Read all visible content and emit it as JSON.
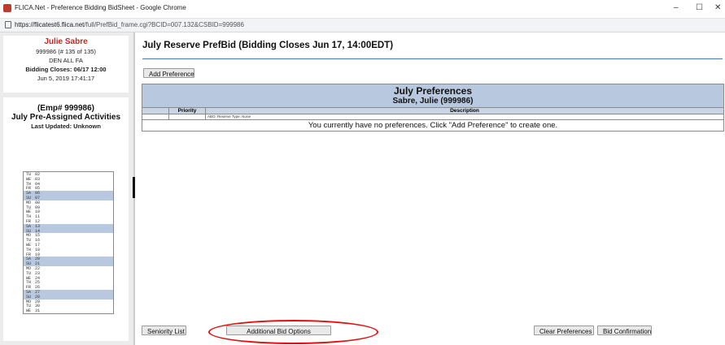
{
  "browser": {
    "window_title": "FLICA.Net - Preference Bidding BidSheet - Google Chrome",
    "url_host": "https://flicatest6.flica.net",
    "url_path": "/full/PrefBid_frame.cgi?BCID=007.132&CSBID=999986",
    "minimize": "–",
    "maximize": "☐",
    "close": "✕"
  },
  "user": {
    "name": "Julie Sabre",
    "id_line": "999986 (# 135 of 135)",
    "base_line": "DEN ALL FA",
    "bidding_closes": "Bidding Closes: 06/17 12:00",
    "timestamp": "Jun 5, 2019 17:41:17"
  },
  "activities": {
    "emp": "(Emp# 999986)",
    "title": "July Pre-Assigned Activities",
    "updated": "Last Updated: Unknown",
    "days": [
      {
        "dow": "TU",
        "d": "02"
      },
      {
        "dow": "WE",
        "d": "03"
      },
      {
        "dow": "TH",
        "d": "04"
      },
      {
        "dow": "FR",
        "d": "05"
      },
      {
        "dow": "SA",
        "d": "06"
      },
      {
        "dow": "SU",
        "d": "07"
      },
      {
        "dow": "MO",
        "d": "08"
      },
      {
        "dow": "TU",
        "d": "09"
      },
      {
        "dow": "WE",
        "d": "10"
      },
      {
        "dow": "TH",
        "d": "11"
      },
      {
        "dow": "FR",
        "d": "12"
      },
      {
        "dow": "SA",
        "d": "13"
      },
      {
        "dow": "SU",
        "d": "14"
      },
      {
        "dow": "MO",
        "d": "15"
      },
      {
        "dow": "TU",
        "d": "16"
      },
      {
        "dow": "WE",
        "d": "17"
      },
      {
        "dow": "TH",
        "d": "18"
      },
      {
        "dow": "FR",
        "d": "19"
      },
      {
        "dow": "SA",
        "d": "20"
      },
      {
        "dow": "SU",
        "d": "21"
      },
      {
        "dow": "MO",
        "d": "22"
      },
      {
        "dow": "TU",
        "d": "23"
      },
      {
        "dow": "WE",
        "d": "24"
      },
      {
        "dow": "TH",
        "d": "25"
      },
      {
        "dow": "FR",
        "d": "26"
      },
      {
        "dow": "SA",
        "d": "27"
      },
      {
        "dow": "SU",
        "d": "28"
      },
      {
        "dow": "MO",
        "d": "29"
      },
      {
        "dow": "TU",
        "d": "30"
      },
      {
        "dow": "WE",
        "d": "31"
      }
    ]
  },
  "main": {
    "title": "July Reserve PrefBid (Bidding Closes Jun 17, 14:00EDT)",
    "add_preference": "Add Preference",
    "table": {
      "heading": "July Preferences",
      "subheading": "Sabre, Julie (999986)",
      "col_priority": "Priority",
      "col_description": "Description",
      "sub_description": "ABO: Reserve Type: None",
      "empty_message": "You currently have no preferences. Click \"Add Preference\" to create one."
    }
  },
  "footer": {
    "seniority_list": "Seniority List",
    "additional_bid_options": "Additional Bid Options",
    "clear_preferences": "Clear Preferences",
    "bid_confirmation": "Bid Confirmation"
  },
  "colors": {
    "accent_blue": "#4a74c8",
    "weekend_highlight": "#b8c8de",
    "name_red": "#cc2222",
    "annotation_red": "#e01010"
  }
}
